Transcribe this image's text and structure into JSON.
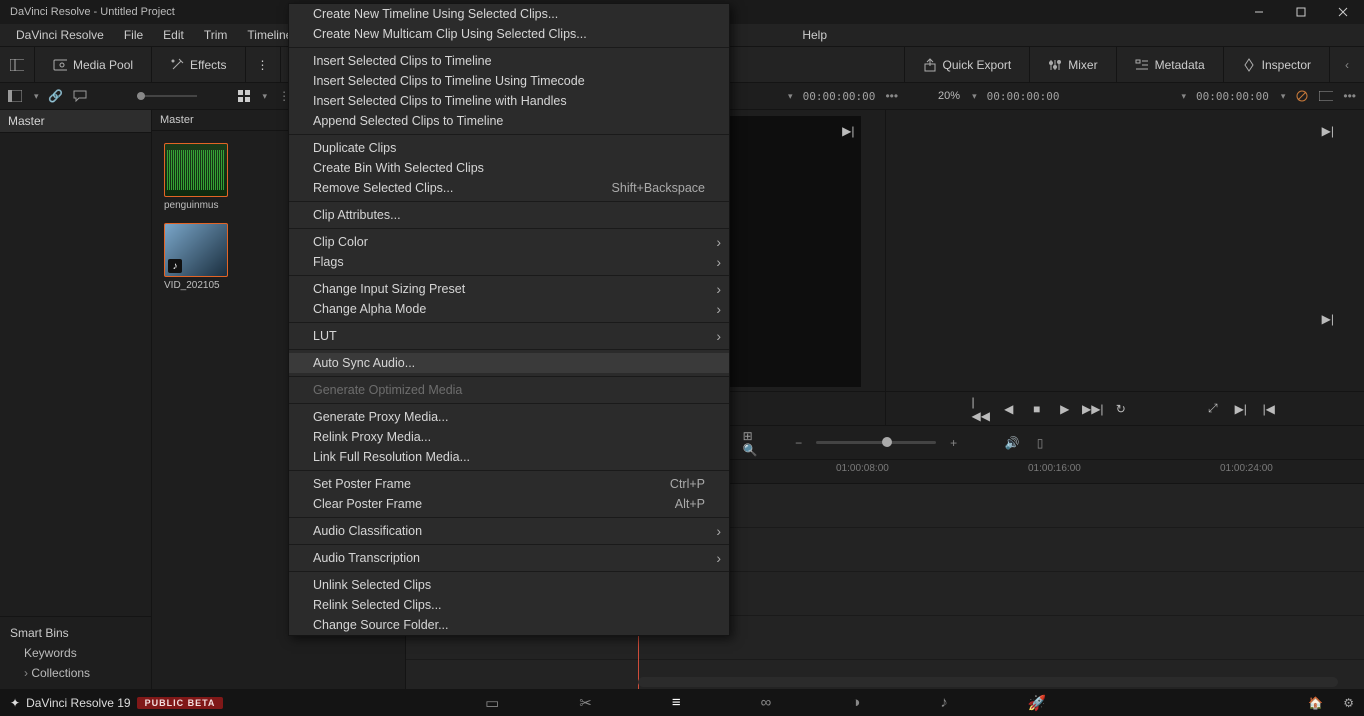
{
  "window": {
    "title": "DaVinci Resolve - Untitled Project"
  },
  "menubar": [
    "DaVinci Resolve",
    "File",
    "Edit",
    "Trim",
    "Timeline",
    "Help"
  ],
  "toolbar": {
    "media_pool": "Media Pool",
    "effects": "Effects",
    "quick_export": "Quick Export",
    "mixer": "Mixer",
    "metadata": "Metadata",
    "inspector": "Inspector"
  },
  "subbar": {
    "left_tc": "00:00:00:00",
    "zoom": "20%",
    "right_tc1": "00:00:00:00",
    "right_tc2": "00:00:00:00"
  },
  "bins": {
    "master": "Master",
    "smart_bins": "Smart Bins",
    "keywords": "Keywords",
    "collections": "Collections"
  },
  "pool": {
    "header": "Master",
    "clip1": "penguinmus",
    "clip2": "VID_202105"
  },
  "timeline": {
    "t8": "01:00:08:00",
    "t16": "01:00:16:00",
    "t24": "01:00:24:00"
  },
  "brand": {
    "name": "DaVinci Resolve 19",
    "badge": "PUBLIC BETA"
  },
  "context_menu": {
    "groups": [
      [
        {
          "label": "Create New Timeline Using Selected Clips..."
        },
        {
          "label": "Create New Multicam Clip Using Selected Clips..."
        }
      ],
      [
        {
          "label": "Insert Selected Clips to Timeline"
        },
        {
          "label": "Insert Selected Clips to Timeline Using Timecode"
        },
        {
          "label": "Insert Selected Clips to Timeline with Handles"
        },
        {
          "label": "Append Selected Clips to Timeline"
        }
      ],
      [
        {
          "label": "Duplicate Clips"
        },
        {
          "label": "Create Bin With Selected Clips"
        },
        {
          "label": "Remove Selected Clips...",
          "shortcut": "Shift+Backspace"
        }
      ],
      [
        {
          "label": "Clip Attributes..."
        }
      ],
      [
        {
          "label": "Clip Color",
          "submenu": true
        },
        {
          "label": "Flags",
          "submenu": true
        }
      ],
      [
        {
          "label": "Change Input Sizing Preset",
          "submenu": true
        },
        {
          "label": "Change Alpha Mode",
          "submenu": true
        }
      ],
      [
        {
          "label": "LUT",
          "submenu": true
        }
      ],
      [
        {
          "label": "Auto Sync Audio...",
          "hover": true
        }
      ],
      [
        {
          "label": "Generate Optimized Media",
          "disabled": true
        }
      ],
      [
        {
          "label": "Generate Proxy Media..."
        },
        {
          "label": "Relink Proxy Media..."
        },
        {
          "label": "Link Full Resolution Media..."
        }
      ],
      [
        {
          "label": "Set Poster Frame",
          "shortcut": "Ctrl+P"
        },
        {
          "label": "Clear Poster Frame",
          "shortcut": "Alt+P"
        }
      ],
      [
        {
          "label": "Audio Classification",
          "submenu": true
        }
      ],
      [
        {
          "label": "Audio Transcription",
          "submenu": true
        }
      ],
      [
        {
          "label": "Unlink Selected Clips"
        },
        {
          "label": "Relink Selected Clips..."
        },
        {
          "label": "Change Source Folder..."
        }
      ]
    ]
  }
}
